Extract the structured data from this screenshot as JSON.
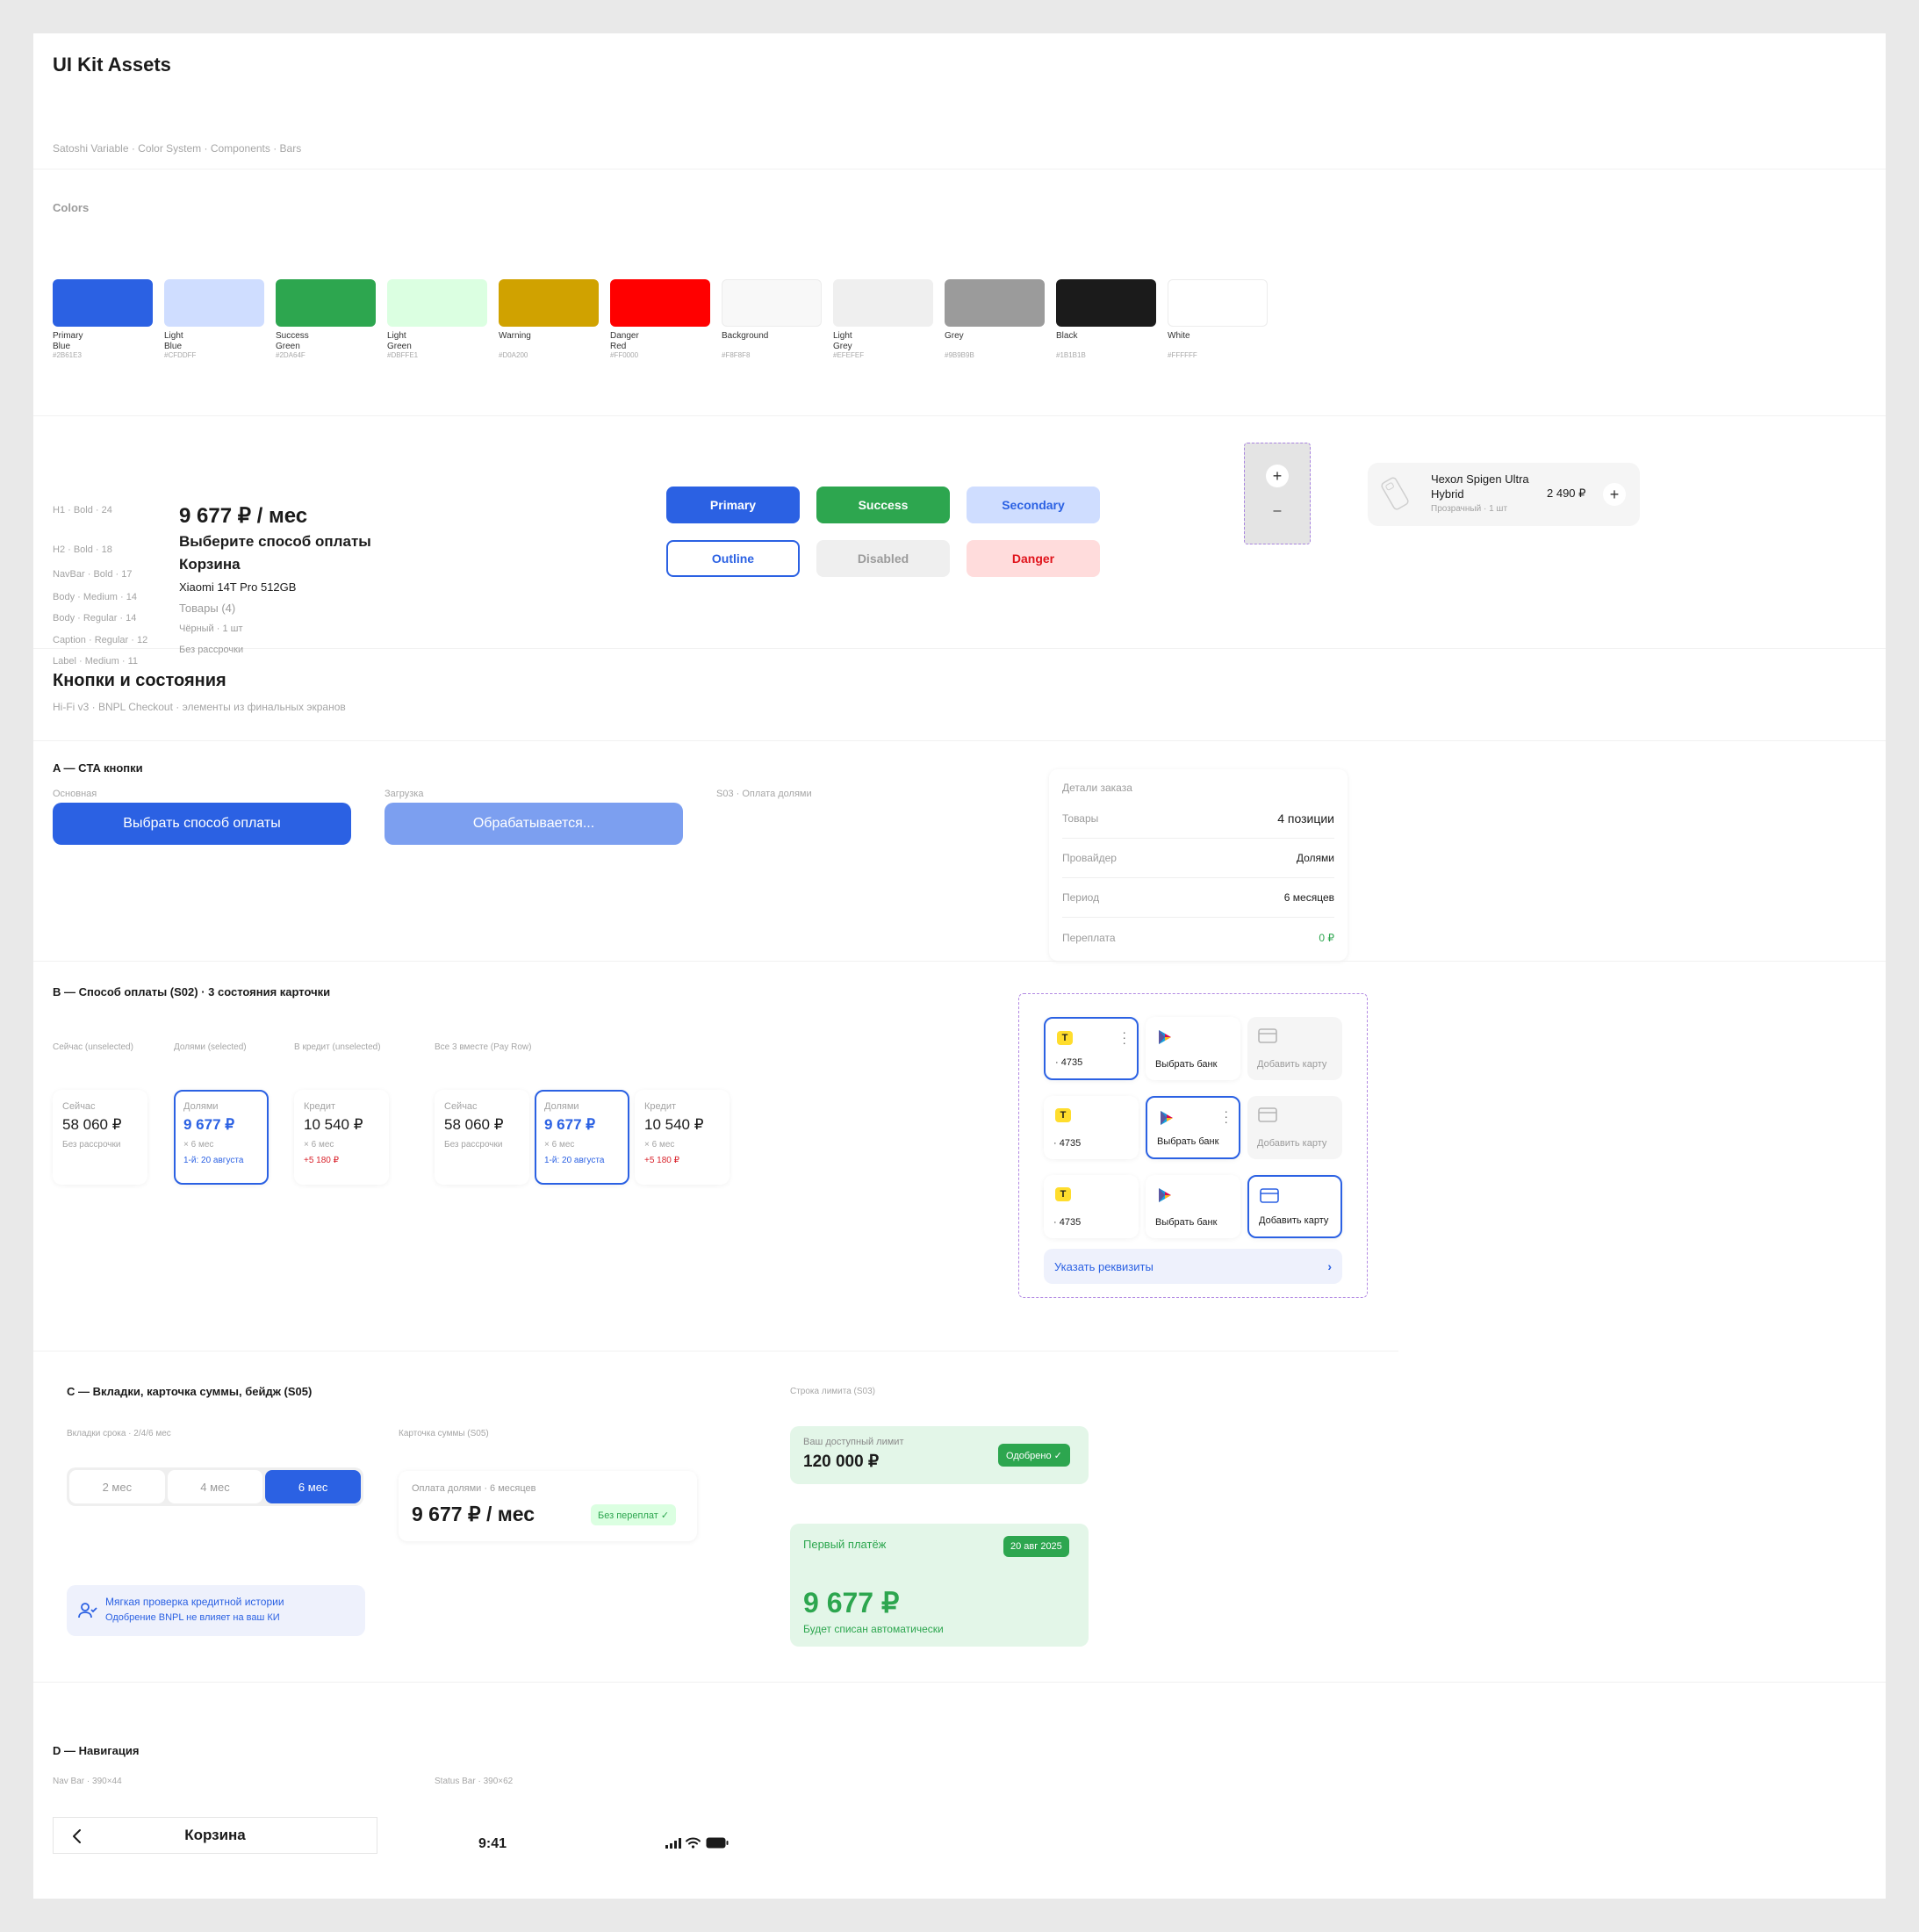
{
  "title": "UI Kit Assets",
  "subtitle": "Satoshi Variable · Color System · Components · Bars",
  "colors_heading": "Colors",
  "colors": [
    {
      "name1": "Primary",
      "name2": "Blue",
      "hex": "#2B61E3",
      "fill": "#2b61e3"
    },
    {
      "name1": "Light",
      "name2": "Blue",
      "hex": "#CFDDFF",
      "fill": "#cfddff"
    },
    {
      "name1": "Success",
      "name2": "Green",
      "hex": "#2DA64F",
      "fill": "#2da64f"
    },
    {
      "name1": "Light",
      "name2": "Green",
      "hex": "#DBFFE1",
      "fill": "#dbffe1"
    },
    {
      "name1": "Warning",
      "name2": "",
      "hex": "#D0A200",
      "fill": "#d0a200"
    },
    {
      "name1": "Danger",
      "name2": "Red",
      "hex": "#FF0000",
      "fill": "#ff0000"
    },
    {
      "name1": "Background",
      "name2": "",
      "hex": "#F8F8F8",
      "fill": "#f8f8f8"
    },
    {
      "name1": "Light",
      "name2": "Grey",
      "hex": "#EFEFEF",
      "fill": "#efefef"
    },
    {
      "name1": "Grey",
      "name2": "",
      "hex": "#9B9B9B",
      "fill": "#9b9b9b"
    },
    {
      "name1": "Black",
      "name2": "",
      "hex": "#1B1B1B",
      "fill": "#1b1b1b"
    },
    {
      "name1": "White",
      "name2": "",
      "hex": "#FFFFFF",
      "fill": "#ffffff"
    }
  ],
  "typography": [
    {
      "label": "H1 · Bold · 24",
      "sample": "9 677 ₽ / мес"
    },
    {
      "label": "H2 · Bold · 18",
      "sample": "Выберите способ оплаты"
    },
    {
      "label": "NavBar · Bold · 17",
      "sample": "Корзина"
    },
    {
      "label": "Body · Medium · 14",
      "sample": "Xiaomi 14T Pro 512GB"
    },
    {
      "label": "Body · Regular · 14",
      "sample": "Товары (4)"
    },
    {
      "label": "Caption · Regular · 12",
      "sample": "Чёрный · 1 шт"
    },
    {
      "label": "Label · Medium · 11",
      "sample": "Без рассрочки"
    }
  ],
  "buttons": {
    "primary": "Primary",
    "success": "Success",
    "secondary": "Secondary",
    "outline": "Outline",
    "disabled": "Disabled",
    "danger": "Danger"
  },
  "stepper": {
    "plus": "+",
    "minus": "–"
  },
  "product": {
    "name": "Чехол Spigen Ultra Hybrid",
    "meta": "Прозрачный · 1 шт",
    "price": "2 490 ₽",
    "add": "+"
  },
  "buttons_section": {
    "title": "Кнопки и состояния",
    "subtitle": "Hi-Fi v3 · BNPL Checkout · элементы из финальных экранов"
  },
  "section_a": {
    "title": "A — CTA кнопки",
    "main_label": "Основная",
    "main_button": "Выбрать способ оплаты",
    "loading_label": "Загрузка",
    "loading_button": "Обрабатывается...",
    "s03_label": "S03 · Оплата долями"
  },
  "order": {
    "title": "Детали заказа",
    "rows": [
      {
        "k": "Товары",
        "v": "4 позиции"
      },
      {
        "k": "Провайдер",
        "v": "Долями"
      },
      {
        "k": "Период",
        "v": "6 месяцев"
      },
      {
        "k": "Переплата",
        "v": "0 ₽"
      }
    ]
  },
  "section_b": {
    "title": "B — Способ оплаты (S02) · 3 состояния карточки",
    "labels": [
      "Сейчас (unselected)",
      "Долями (selected)",
      "В кредит (unselected)",
      "Все 3 вместе (Pay Row)"
    ],
    "now": {
      "l": "Сейчас",
      "v": "58 060 ₽",
      "s": "Без рассрочки"
    },
    "parts": {
      "l": "Долями",
      "v": "9 677 ₽",
      "s": "× 6 мес",
      "s2": "1-й: 20 августа"
    },
    "credit": {
      "l": "Кредит",
      "v": "10 540 ₽",
      "s": "× 6 мес",
      "s2": "+5 180 ₽"
    }
  },
  "methods": {
    "tbank_logo": "Т",
    "card_num": "· 4735",
    "choose_bank": "Выбрать банк",
    "add_card": "Добавить карту",
    "details": "Указать реквизиты"
  },
  "section_c": {
    "title": "C — Вкладки, карточка суммы, бейдж (S05)",
    "tabs_label": "Вкладки срока · 2/4/6 мес",
    "tabs": [
      "2 мес",
      "4 мес",
      "6 мес"
    ],
    "sum_label": "Карточка суммы (S05)",
    "sum_caption": "Оплата долями · 6 месяцев",
    "sum_value": "9 677 ₽ / мес",
    "sum_badge": "Без переплат ✓",
    "soft_title": "Мягкая проверка кредитной истории",
    "soft_sub": "Одобрение BNPL не влияет на ваш КИ",
    "limit_label": "Строка лимита (S03)",
    "limit_caption": "Ваш доступный лимит",
    "limit_value": "120 000 ₽",
    "limit_badge": "Одобрено ✓",
    "first_caption": "Первый платёж",
    "first_date": "20 авг 2025",
    "first_value": "9 677 ₽",
    "first_sub": "Будет списан автоматически"
  },
  "section_d": {
    "title": "D — Навигация",
    "nav_label": "Nav Bar · 390×44",
    "status_label": "Status Bar · 390×62",
    "nav_title": "Корзина",
    "time": "9:41"
  }
}
